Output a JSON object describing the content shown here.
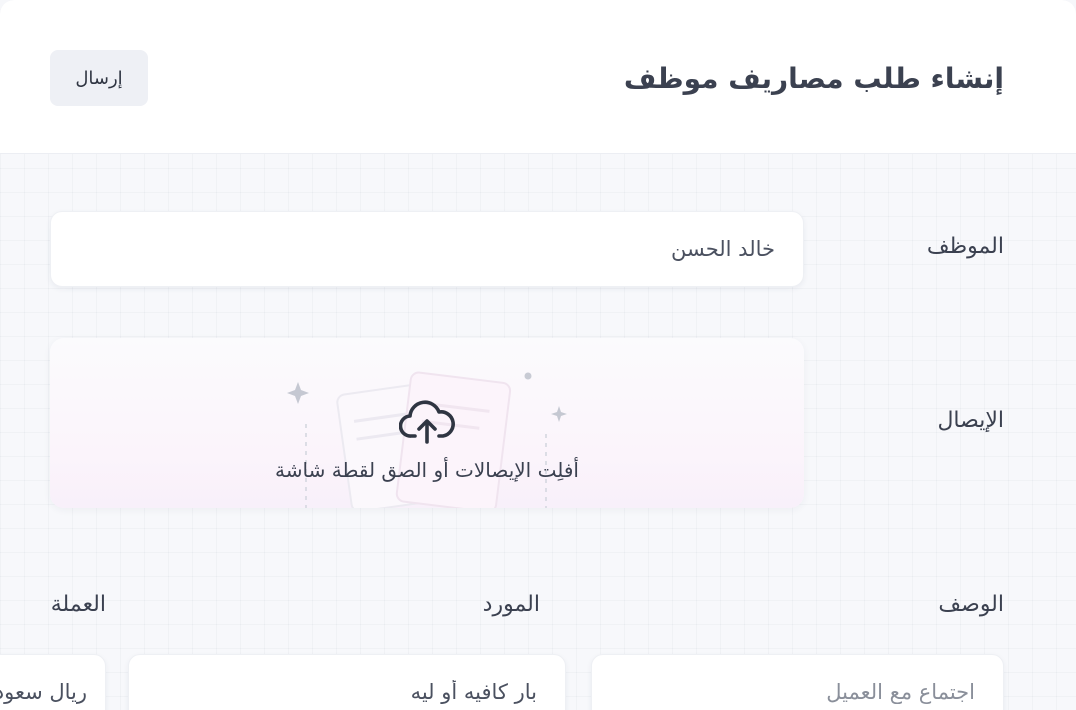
{
  "header": {
    "title": "إنشاء طلب مصاريف موظف",
    "submit_label": "إرسال"
  },
  "form": {
    "employee": {
      "label": "الموظف",
      "value": "خالد الحسن"
    },
    "receipt": {
      "label": "الإيصال",
      "dropzone_text": "أفلِت الإيصالات أو الصق لقطة شاشة",
      "icon": "cloud-upload-icon"
    },
    "description": {
      "label": "الوصف",
      "placeholder": "اجتماع مع العميل"
    },
    "vendor": {
      "label": "المورد",
      "value": "بار كافيه أو ليه"
    },
    "currency": {
      "label": "العملة",
      "value": "ريال سعودي"
    }
  }
}
